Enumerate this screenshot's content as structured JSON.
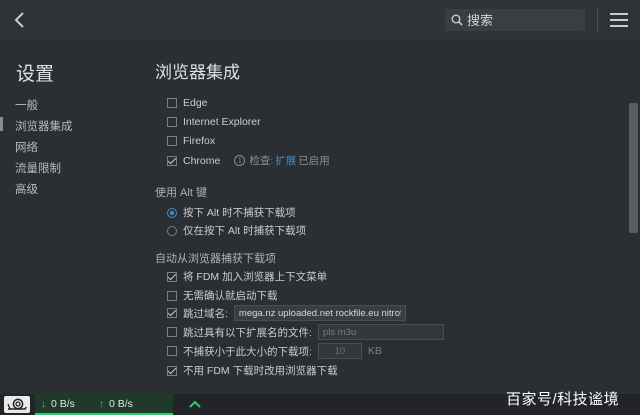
{
  "header": {
    "search_placeholder": "搜索"
  },
  "sidebar": {
    "title": "设置",
    "items": [
      {
        "label": "一般"
      },
      {
        "label": "浏览器集成"
      },
      {
        "label": "网络"
      },
      {
        "label": "流量限制"
      },
      {
        "label": "高级"
      }
    ],
    "active_index": 1
  },
  "main": {
    "title": "浏览器集成",
    "browsers": [
      {
        "label": "Edge",
        "checked": false
      },
      {
        "label": "Internet Explorer",
        "checked": false
      },
      {
        "label": "Firefox",
        "checked": false
      },
      {
        "label": "Chrome",
        "checked": true
      }
    ],
    "chrome_status": {
      "check_label": "检查:",
      "extension_link": "扩展",
      "enabled_text": "已启用"
    },
    "alt_key": {
      "label": "使用 Alt 键",
      "options": [
        {
          "label": "按下 Alt 时不捕获下载项",
          "selected": true
        },
        {
          "label": "仅在按下 Alt 时捕获下载项",
          "selected": false
        }
      ]
    },
    "auto_capture": {
      "label": "自动从浏览器捕获下载项",
      "add_to_context_menu": {
        "label": "将 FDM 加入浏览器上下文菜单",
        "checked": true
      },
      "start_without_confirm": {
        "label": "无需确认就启动下载",
        "checked": false
      },
      "skip_domains": {
        "label": "跳过域名:",
        "checked": true,
        "value": "mega.nz uploaded.net rockfile.eu nitroflare.com ra"
      },
      "skip_extensions": {
        "label": "跳过具有以下扩展名的文件:",
        "checked": false,
        "placeholder": "pls m3u"
      },
      "skip_small": {
        "label": "不捕获小于此大小的下载项:",
        "checked": false,
        "value": "10",
        "unit": "KB"
      },
      "use_browser_on_fail": {
        "label": "不用 FDM 下载时改用浏览器下载",
        "checked": true
      }
    }
  },
  "statusbar": {
    "download_speed": "0 B/s",
    "upload_speed": "0 B/s"
  },
  "watermark": "百家号/科技谧境",
  "colors": {
    "background": "#2b2e33",
    "accent": "#3a8fd6",
    "speed_green": "#2ecc71"
  }
}
